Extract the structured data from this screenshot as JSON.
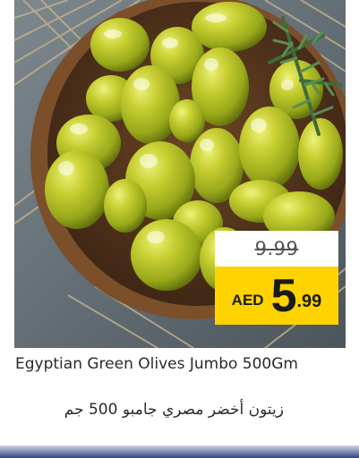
{
  "product": {
    "name_en": "Egyptian Green Olives Jumbo 500Gm",
    "name_ar": "زيتون أخضر مصري جامبو 500 جم",
    "image_icon": "green-olives-bowl-photo"
  },
  "price": {
    "old": "9.99",
    "currency": "AED",
    "new_integer": "5",
    "new_decimal": ".99"
  },
  "colors": {
    "price_background": "#ffd300",
    "old_price_background": "#ffffff",
    "bottom_bar": "#2f4680"
  }
}
